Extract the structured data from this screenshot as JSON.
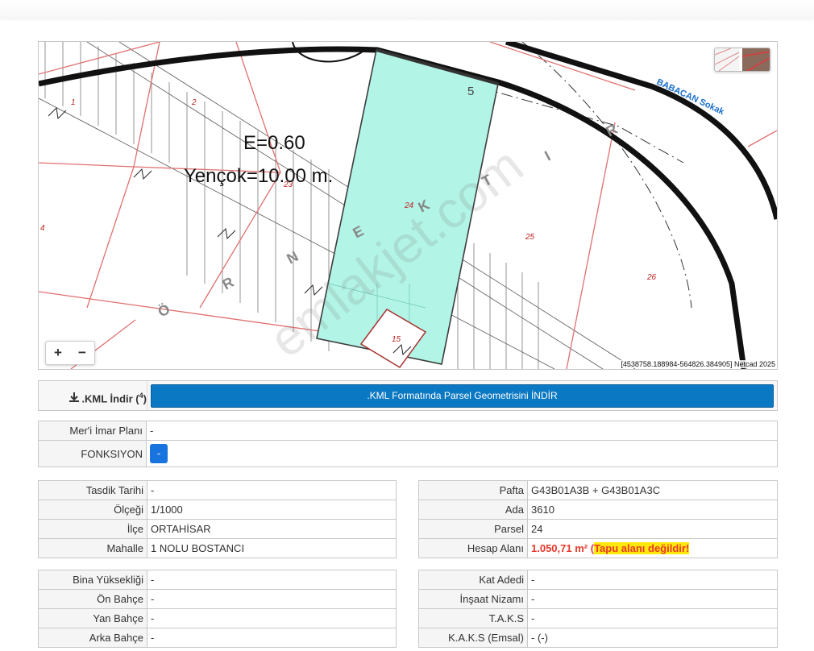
{
  "map": {
    "labels": {
      "e_value": "E=0.60",
      "yencok": "Yençok=10.00 m.",
      "street": "BABACAN Sokak",
      "parcel_numbers": [
        "1",
        "2",
        "23",
        "4",
        "24",
        "25",
        "26",
        "15",
        "5"
      ],
      "district_letters": [
        "Ö",
        "R",
        "N",
        "E",
        "K",
        "T",
        "I",
        "R"
      ]
    },
    "zoom_in": "+",
    "zoom_out": "−",
    "coordinates": "[4538758.188984-564826.384905] Netcad 2025",
    "highlight_color": "#b2f4e6"
  },
  "watermark": "emlakjet.com",
  "kml": {
    "label": ".KML İndir (",
    "label_sup": "4",
    "label_end": ")",
    "button": ".KML Formatında Parsel Geometrisini İNDİR"
  },
  "plan": {
    "rows": [
      {
        "key": "Mer'i İmar Planı",
        "value": "-"
      },
      {
        "key": "FONKSIYON",
        "button": "-"
      }
    ]
  },
  "left1": [
    {
      "key": "Tasdik Tarihi",
      "value": "-"
    },
    {
      "key": "Ölçeği",
      "value": "1/1000"
    },
    {
      "key": "İlçe",
      "value": "ORTAHİSAR"
    },
    {
      "key": "Mahalle",
      "value": "1 NOLU BOSTANCI"
    }
  ],
  "right1": [
    {
      "key": "Pafta",
      "value": "G43B01A3B + G43B01A3C"
    },
    {
      "key": "Ada",
      "value": "3610"
    },
    {
      "key": "Parsel",
      "value": "24"
    },
    {
      "key": "Hesap Alanı",
      "area": "1.050,71 m²",
      "open": " (",
      "note": "Tapu alanı değildir!"
    }
  ],
  "left2": [
    {
      "key": "Bina Yüksekliği",
      "value": "-"
    },
    {
      "key": "Ön Bahçe",
      "value": "-"
    },
    {
      "key": "Yan Bahçe",
      "value": "-"
    },
    {
      "key": "Arka Bahçe",
      "value": "-"
    }
  ],
  "right2": [
    {
      "key": "Kat Adedi",
      "value": "-"
    },
    {
      "key": "İnşaat Nizamı",
      "value": "-"
    },
    {
      "key": "T.A.K.S",
      "value": "-"
    },
    {
      "key": "K.A.K.S (Emsal)",
      "value": "- (-)"
    }
  ]
}
